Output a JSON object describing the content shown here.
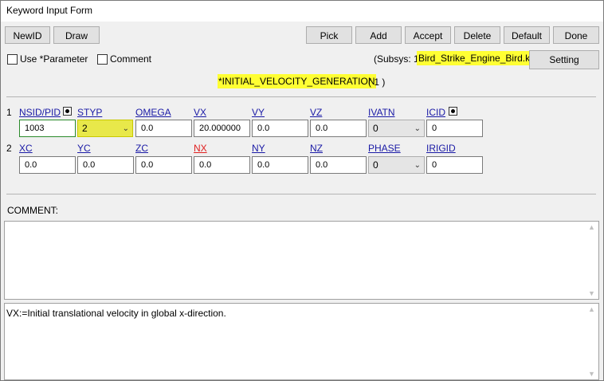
{
  "window": {
    "title": "Keyword Input Form"
  },
  "toolbar": {
    "newid": "NewID",
    "draw": "Draw",
    "pick": "Pick",
    "add": "Add",
    "accept": "Accept",
    "delete": "Delete",
    "default": "Default",
    "done": "Done"
  },
  "options": {
    "use_parameter": "Use *Parameter",
    "comment": "Comment",
    "subsys_prefix": "(Subsys: 1",
    "subsys_file": "Bird_Strike_Engine_Bird.k)",
    "setting": "Setting"
  },
  "keyword": {
    "name": "*INITIAL_VELOCITY_GENERATION",
    "count": "( 1 )"
  },
  "row1": {
    "num": "1",
    "headers": [
      "NSID/PID",
      "STYP",
      "OMEGA",
      "VX",
      "VY",
      "VZ",
      "IVATN",
      "ICID"
    ],
    "values": {
      "nsid": "1003",
      "styp": "2",
      "omega": "0.0",
      "vx": "20.000000",
      "vy": "0.0",
      "vz": "0.0",
      "ivatn": "0",
      "icid": "0"
    }
  },
  "row2": {
    "num": "2",
    "headers": [
      "XC",
      "YC",
      "ZC",
      "NX",
      "NY",
      "NZ",
      "PHASE",
      "IRIGID"
    ],
    "values": {
      "xc": "0.0",
      "yc": "0.0",
      "zc": "0.0",
      "nx": "0.0",
      "ny": "0.0",
      "nz": "0.0",
      "phase": "0",
      "irigid": "0"
    }
  },
  "comment": {
    "label": "COMMENT:",
    "text": ""
  },
  "help": {
    "text": "VX:=Initial translational velocity in global x-direction."
  },
  "colors": {
    "highlight": "#ffff33",
    "link": "#1a1aa6",
    "warning": "#e02020"
  }
}
